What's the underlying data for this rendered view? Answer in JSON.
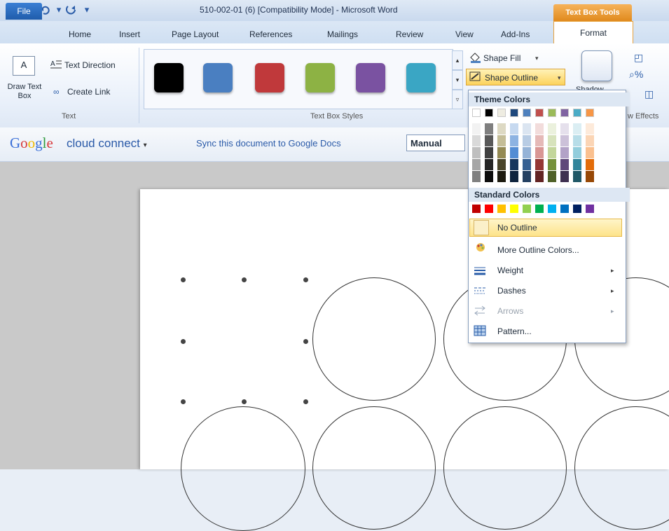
{
  "title": "510-002-01 (6) [Compatibility Mode] - Microsoft Word",
  "contextual_tab": "Text Box Tools",
  "tabs": [
    "File",
    "Home",
    "Insert",
    "Page Layout",
    "References",
    "Mailings",
    "Review",
    "View",
    "Add-Ins",
    "Format"
  ],
  "ribbon": {
    "text_group": {
      "draw_text_box": "Draw Text Box",
      "text_direction": "Text Direction",
      "create_link": "Create Link",
      "label": "Text"
    },
    "styles_group": {
      "label": "Text Box Styles",
      "swatch_colors": [
        "#000000",
        "#4a7fc1",
        "#c0393b",
        "#8db244",
        "#7a52a1",
        "#3aa6c4"
      ]
    },
    "shape_fill": "Shape Fill",
    "shape_outline": "Shape Outline",
    "shadow_label": "Shadow",
    "effects_label": "w Effects"
  },
  "google_bar": {
    "brand_google": "Google",
    "brand_product": "cloud connect",
    "sync_text": "Sync this document to Google Docs",
    "sync_mode": "Manual"
  },
  "menu": {
    "theme_header": "Theme Colors",
    "standard_header": "Standard Colors",
    "theme_top_row": [
      "#ffffff",
      "#000000",
      "#eeece1",
      "#1f497d",
      "#4f81bd",
      "#c0504d",
      "#9bbb59",
      "#8064a2",
      "#4bacc6",
      "#f79646"
    ],
    "theme_columns": [
      [
        "#f2f2f2",
        "#d9d9d9",
        "#bfbfbf",
        "#a6a6a6",
        "#808080"
      ],
      [
        "#7f7f7f",
        "#595959",
        "#404040",
        "#262626",
        "#0d0d0d"
      ],
      [
        "#ddd9c3",
        "#c4bd97",
        "#948a54",
        "#4a452a",
        "#1d1b10"
      ],
      [
        "#c6d9f0",
        "#8db3e2",
        "#548dd4",
        "#17365d",
        "#0f243e"
      ],
      [
        "#dbe5f1",
        "#b8cce4",
        "#95b3d7",
        "#366092",
        "#244061"
      ],
      [
        "#f2dcdb",
        "#e5b9b7",
        "#d99694",
        "#953734",
        "#632423"
      ],
      [
        "#ebf1dd",
        "#d7e3bc",
        "#c3d69b",
        "#76923c",
        "#4f6128"
      ],
      [
        "#e5e0ec",
        "#ccc1d9",
        "#b2a2c7",
        "#5f497a",
        "#3f3151"
      ],
      [
        "#dbeef3",
        "#b7dde8",
        "#92cddc",
        "#31859b",
        "#205867"
      ],
      [
        "#fdeada",
        "#fbd5b5",
        "#fac08f",
        "#e36c09",
        "#974806"
      ]
    ],
    "standard_colors": [
      "#c00000",
      "#ff0000",
      "#ffc000",
      "#ffff00",
      "#92d050",
      "#00b050",
      "#00b0f0",
      "#0070c0",
      "#002060",
      "#7030a0"
    ],
    "items": {
      "no_outline": "No Outline",
      "more_colors": "More Outline Colors...",
      "weight": "Weight",
      "dashes": "Dashes",
      "arrows": "Arrows",
      "pattern": "Pattern..."
    }
  }
}
